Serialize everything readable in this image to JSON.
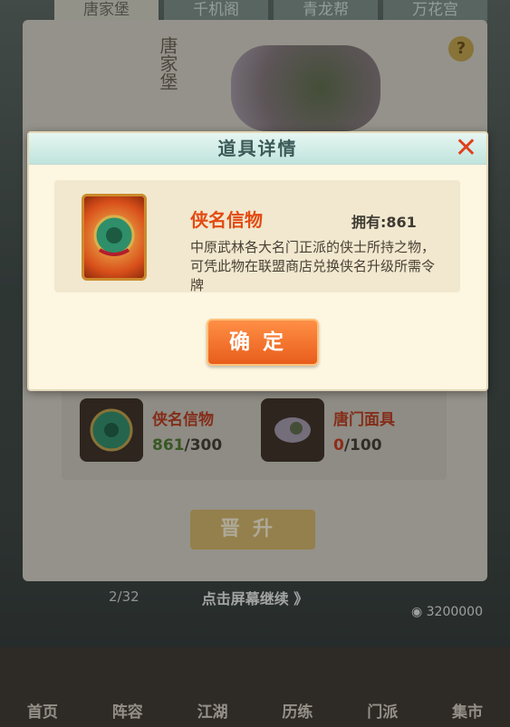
{
  "tabs": [
    "唐家堡",
    "千机阁",
    "青龙帮",
    "万花宫"
  ],
  "banner_text": "唐家堡",
  "requirements": [
    {
      "name": "侠名信物",
      "owned": "861",
      "required": "/300",
      "owned_color": "#4a7b2c"
    },
    {
      "name": "唐门面具",
      "owned": "0",
      "required": "/100",
      "owned_color": "#d2361b"
    }
  ],
  "promote_label": "晋升",
  "continue_text": "点击屏幕继续 》",
  "bottom_count": "2/32",
  "coins": "3200000",
  "nav": [
    "首页",
    "阵容",
    "江湖",
    "历练",
    "门派",
    "集市"
  ],
  "modal": {
    "title": "道具详情",
    "item_name": "侠名信物",
    "owned_label": "拥有:",
    "owned_value": "861",
    "description": "中原武林各大名门正派的侠士所持之物，可凭此物在联盟商店兑换侠名升级所需令牌",
    "confirm_label": "确定"
  }
}
